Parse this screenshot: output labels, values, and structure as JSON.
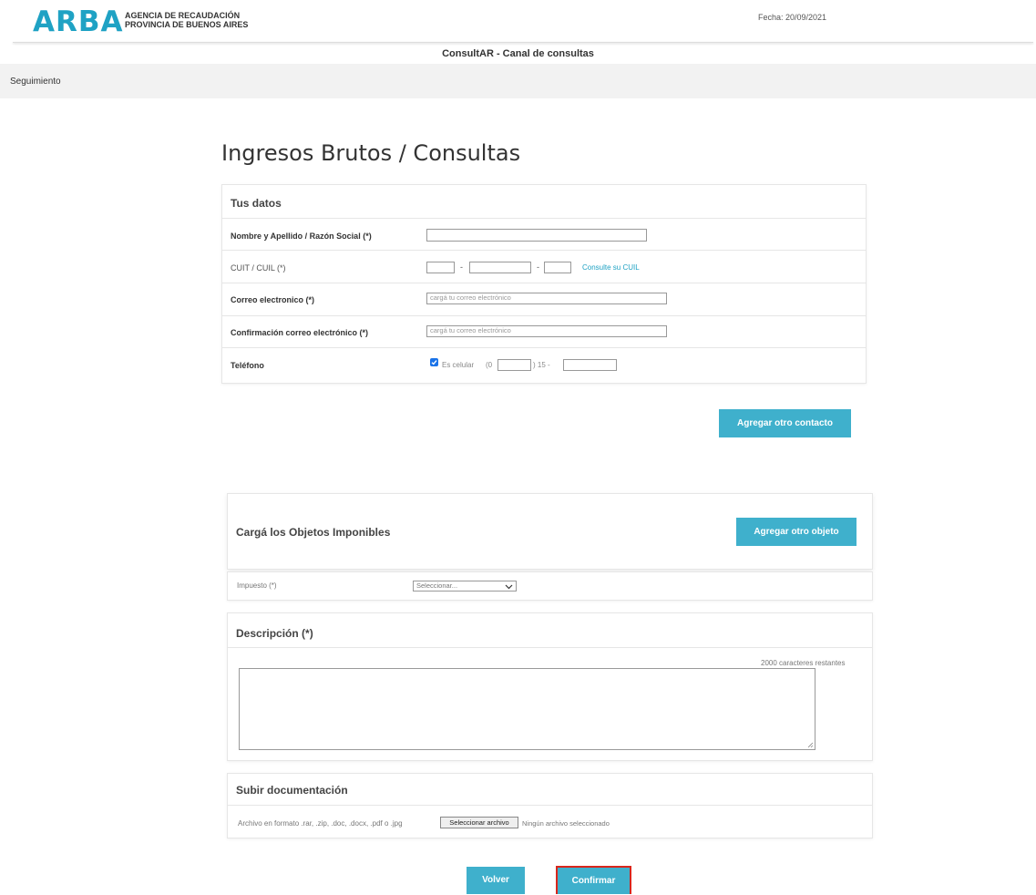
{
  "header": {
    "logo": "ARBA",
    "agency_line1": "AGENCIA DE RECAUDACIÓN",
    "agency_line2": "PROVINCIA DE BUENOS AIRES",
    "fecha": "Fecha: 20/09/2021",
    "channel_title": "ConsultAR - Canal de consultas",
    "nav_link": "Seguimiento"
  },
  "page_title": "Ingresos Brutos / Consultas",
  "tus_datos": {
    "title": "Tus datos",
    "nombre_label": "Nombre y Apellido / Razón Social (*)",
    "cuit_label": "CUIT / CUIL (*)",
    "cuit_sep": "-",
    "cuit_link": "Consulte su CUIL",
    "correo_label": "Correo electronico (*)",
    "correo_placeholder": "cargá tu correo electrónico",
    "confirm_label": "Confirmación correo electrónico (*)",
    "confirm_placeholder": "cargá tu correo electrónico",
    "telefono_label": "Teléfono",
    "es_celular": "Es celular",
    "tel_prefix": "(0",
    "tel_mid": ") 15 -",
    "es_celular_checked": true
  },
  "agregar_contacto": "Agregar otro contacto",
  "objetos": {
    "title": "Cargá los Objetos Imponibles",
    "add_button": "Agregar otro objeto",
    "impuesto_label": "Impuesto (*)",
    "impuesto_value": "Seleccionar..."
  },
  "descripcion": {
    "title": "Descripción (*)",
    "remaining": "2000 caracteres restantes"
  },
  "documentacion": {
    "title": "Subir documentación",
    "hint": "Archivo en formato .rar, .zip, .doc, .docx, .pdf o .jpg",
    "file_button": "Seleccionar archivo",
    "file_status": "Ningún archivo seleccionado"
  },
  "actions": {
    "volver": "Volver",
    "confirmar": "Confirmar"
  },
  "colors": {
    "brand": "#1fa2c4",
    "button": "#3fb0cc",
    "highlight_border": "#d9261c"
  }
}
